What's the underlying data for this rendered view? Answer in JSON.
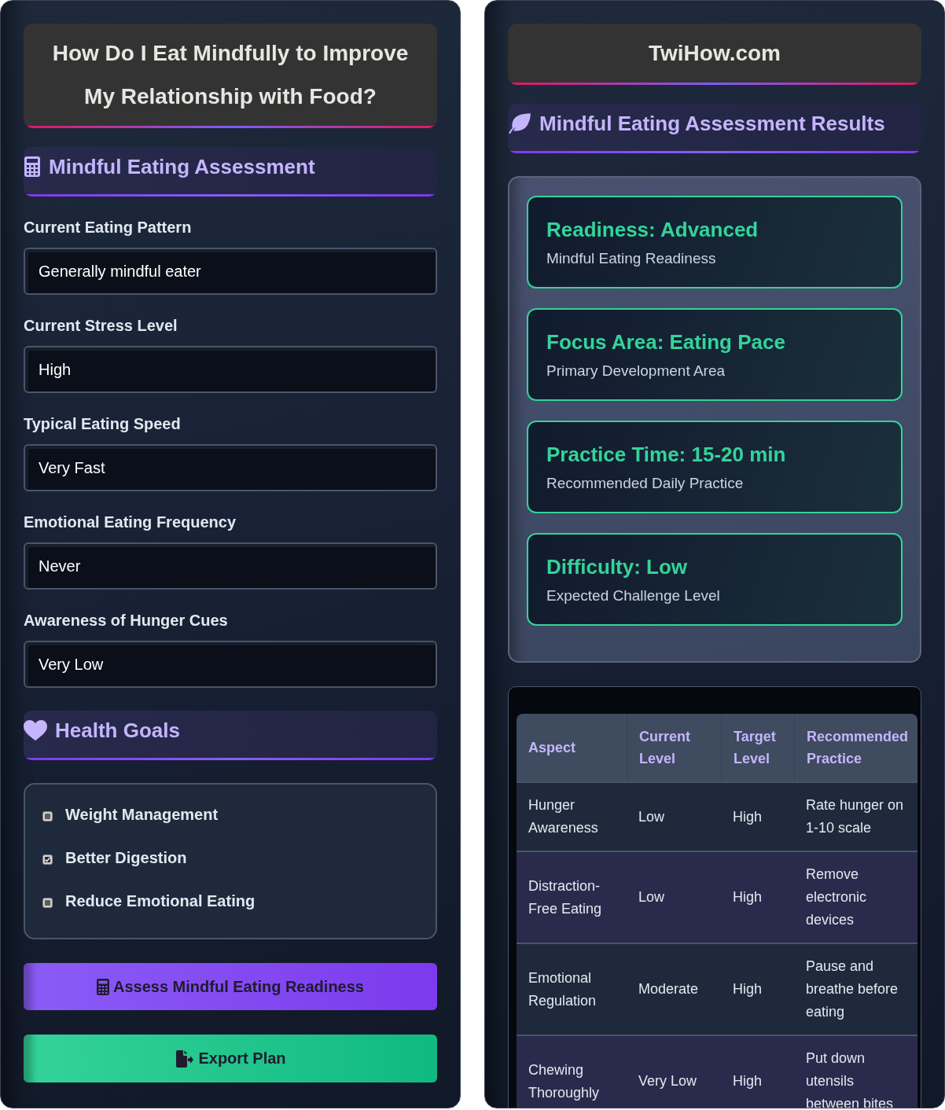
{
  "left_panel": {
    "title": "How Do I Eat Mindfully to Improve My Relationship with Food?",
    "assessment_title": "Mindful Eating Assessment",
    "fields": [
      {
        "label": "Current Eating Pattern",
        "value": "Generally mindful eater"
      },
      {
        "label": "Current Stress Level",
        "value": "High"
      },
      {
        "label": "Typical Eating Speed",
        "value": "Very Fast"
      },
      {
        "label": "Emotional Eating Frequency",
        "value": "Never"
      },
      {
        "label": "Awareness of Hunger Cues",
        "value": "Very Low"
      }
    ],
    "goals_title": "Health Goals",
    "goals": [
      {
        "label": "Weight Management",
        "checked": false
      },
      {
        "label": "Better Digestion",
        "checked": true
      },
      {
        "label": "Reduce Emotional Eating",
        "checked": false
      }
    ],
    "buttons": [
      {
        "label": "Assess Mindful Eating Readiness",
        "kind": "assess"
      },
      {
        "label": "Export Plan",
        "kind": "export"
      }
    ]
  },
  "right_panel": {
    "site_title": "TwiHow.com",
    "results_title": "Mindful Eating Assessment Results",
    "results": [
      {
        "value": "Readiness: Advanced",
        "caption": "Mindful Eating Readiness"
      },
      {
        "value": "Focus Area: Eating Pace",
        "caption": "Primary Development Area"
      },
      {
        "value": "Practice Time: 15-20 min",
        "caption": "Recommended Daily Practice"
      },
      {
        "value": "Difficulty: Low",
        "caption": "Expected Challenge Level"
      }
    ],
    "table": {
      "columns": [
        "Aspect",
        "Current Level",
        "Target Level",
        "Recommended Practice"
      ],
      "rows": [
        [
          "Hunger Awareness",
          "Low",
          "High",
          "Rate hunger on 1-10 scale"
        ],
        [
          "Distraction-Free Eating",
          "Low",
          "High",
          "Remove electronic devices"
        ],
        [
          "Emotional Regulation",
          "Moderate",
          "High",
          "Pause and breathe before eating"
        ],
        [
          "Chewing Thoroughly",
          "Very Low",
          "High",
          "Put down utensils between bites"
        ]
      ]
    }
  }
}
